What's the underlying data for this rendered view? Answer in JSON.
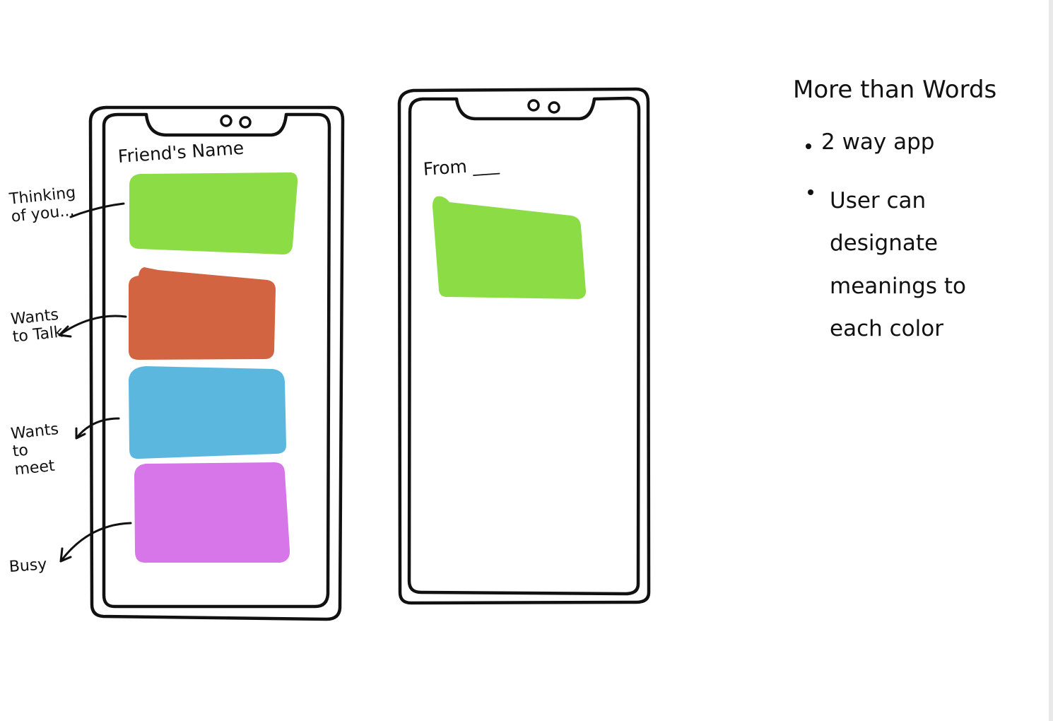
{
  "left_phone": {
    "header": "Friend's Name",
    "swatches": [
      {
        "label": "Thinking of you...",
        "color": "#8bdc45"
      },
      {
        "label": "Wants to Talk",
        "color": "#d26442"
      },
      {
        "label": "Wants to meet",
        "color": "#5bb7dd"
      },
      {
        "label": "Busy",
        "color": "#d676e8"
      }
    ]
  },
  "right_phone": {
    "header": "From ___",
    "swatch": {
      "color": "#8bdc45"
    }
  },
  "notes": {
    "title": "More than Words",
    "bullets": [
      "2 way app",
      "User can designate meanings to each color"
    ]
  }
}
